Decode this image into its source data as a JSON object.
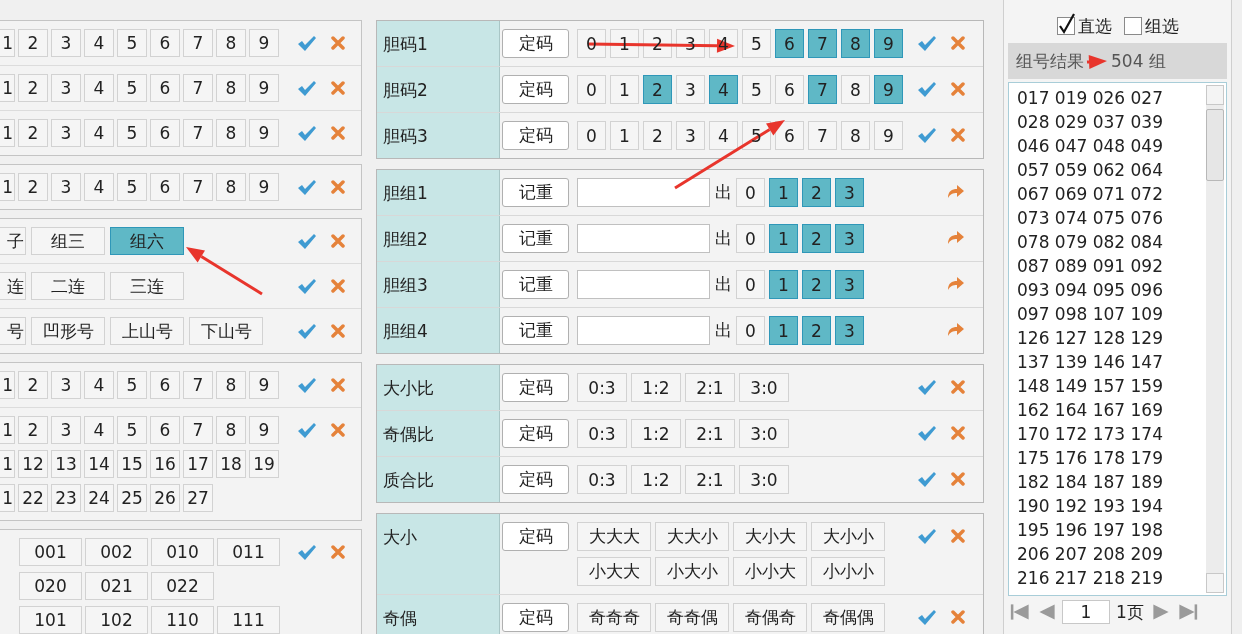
{
  "left_panel": {
    "groups": [
      {
        "kind": "digits",
        "rows": [
          {
            "lines": [
              [
                {
                  "label": "1",
                  "selected": false
                },
                {
                  "label": "2",
                  "selected": false
                },
                {
                  "label": "3",
                  "selected": false
                },
                {
                  "label": "4",
                  "selected": false
                },
                {
                  "label": "5",
                  "selected": false
                },
                {
                  "label": "6",
                  "selected": false
                },
                {
                  "label": "7",
                  "selected": false
                },
                {
                  "label": "8",
                  "selected": false
                },
                {
                  "label": "9",
                  "selected": false
                }
              ]
            ]
          },
          {
            "lines": [
              [
                {
                  "label": "1",
                  "selected": false
                },
                {
                  "label": "2",
                  "selected": false
                },
                {
                  "label": "3",
                  "selected": false
                },
                {
                  "label": "4",
                  "selected": false
                },
                {
                  "label": "5",
                  "selected": false
                },
                {
                  "label": "6",
                  "selected": false
                },
                {
                  "label": "7",
                  "selected": false
                },
                {
                  "label": "8",
                  "selected": false
                },
                {
                  "label": "9",
                  "selected": false
                }
              ]
            ]
          },
          {
            "lines": [
              [
                {
                  "label": "1",
                  "selected": false
                },
                {
                  "label": "2",
                  "selected": false
                },
                {
                  "label": "3",
                  "selected": false
                },
                {
                  "label": "4",
                  "selected": false
                },
                {
                  "label": "5",
                  "selected": false
                },
                {
                  "label": "6",
                  "selected": false
                },
                {
                  "label": "7",
                  "selected": false
                },
                {
                  "label": "8",
                  "selected": false
                },
                {
                  "label": "9",
                  "selected": false
                }
              ]
            ]
          }
        ]
      },
      {
        "kind": "digits",
        "rows": [
          {
            "lines": [
              [
                {
                  "label": "1",
                  "selected": false
                },
                {
                  "label": "2",
                  "selected": false
                },
                {
                  "label": "3",
                  "selected": false
                },
                {
                  "label": "4",
                  "selected": false
                },
                {
                  "label": "5",
                  "selected": false
                },
                {
                  "label": "6",
                  "selected": false
                },
                {
                  "label": "7",
                  "selected": false
                },
                {
                  "label": "8",
                  "selected": false
                },
                {
                  "label": "9",
                  "selected": false
                }
              ]
            ]
          }
        ]
      },
      {
        "kind": "words",
        "rows": [
          {
            "lines": [
              [
                {
                  "label": "子",
                  "selected": false
                },
                {
                  "label": "组三",
                  "selected": false
                },
                {
                  "label": "组六",
                  "selected": true
                }
              ]
            ]
          },
          {
            "lines": [
              [
                {
                  "label": "连",
                  "selected": false
                },
                {
                  "label": "二连",
                  "selected": false
                },
                {
                  "label": "三连",
                  "selected": false
                }
              ]
            ]
          },
          {
            "lines": [
              [
                {
                  "label": "号",
                  "selected": false
                },
                {
                  "label": "凹形号",
                  "selected": false
                },
                {
                  "label": "上山号",
                  "selected": false
                },
                {
                  "label": "下山号",
                  "selected": false
                }
              ]
            ]
          }
        ]
      },
      {
        "kind": "digits",
        "rows": [
          {
            "lines": [
              [
                {
                  "label": "1",
                  "selected": false
                },
                {
                  "label": "2",
                  "selected": false
                },
                {
                  "label": "3",
                  "selected": false
                },
                {
                  "label": "4",
                  "selected": false
                },
                {
                  "label": "5",
                  "selected": false
                },
                {
                  "label": "6",
                  "selected": false
                },
                {
                  "label": "7",
                  "selected": false
                },
                {
                  "label": "8",
                  "selected": false
                },
                {
                  "label": "9",
                  "selected": false
                }
              ]
            ]
          },
          {
            "lines": [
              [
                {
                  "label": "1",
                  "selected": false
                },
                {
                  "label": "2",
                  "selected": false
                },
                {
                  "label": "3",
                  "selected": false
                },
                {
                  "label": "4",
                  "selected": false
                },
                {
                  "label": "5",
                  "selected": false
                },
                {
                  "label": "6",
                  "selected": false
                },
                {
                  "label": "7",
                  "selected": false
                },
                {
                  "label": "8",
                  "selected": false
                },
                {
                  "label": "9",
                  "selected": false
                }
              ],
              [
                {
                  "label": "1",
                  "selected": false
                },
                {
                  "label": "12",
                  "selected": false
                },
                {
                  "label": "13",
                  "selected": false
                },
                {
                  "label": "14",
                  "selected": false
                },
                {
                  "label": "15",
                  "selected": false
                },
                {
                  "label": "16",
                  "selected": false
                },
                {
                  "label": "17",
                  "selected": false
                },
                {
                  "label": "18",
                  "selected": false
                },
                {
                  "label": "19",
                  "selected": false
                }
              ],
              [
                {
                  "label": "1",
                  "selected": false
                },
                {
                  "label": "22",
                  "selected": false
                },
                {
                  "label": "23",
                  "selected": false
                },
                {
                  "label": "24",
                  "selected": false
                },
                {
                  "label": "25",
                  "selected": false
                },
                {
                  "label": "26",
                  "selected": false
                },
                {
                  "label": "27",
                  "selected": false
                }
              ]
            ]
          }
        ]
      },
      {
        "kind": "codes",
        "rows": [
          {
            "lines": [
              [
                {
                  "label": "001",
                  "selected": false
                },
                {
                  "label": "002",
                  "selected": false
                },
                {
                  "label": "010",
                  "selected": false
                },
                {
                  "label": "011",
                  "selected": false
                }
              ],
              [
                {
                  "label": "020",
                  "selected": false
                },
                {
                  "label": "021",
                  "selected": false
                },
                {
                  "label": "022",
                  "selected": false
                }
              ],
              [
                {
                  "label": "101",
                  "selected": false
                },
                {
                  "label": "102",
                  "selected": false
                },
                {
                  "label": "110",
                  "selected": false
                },
                {
                  "label": "111",
                  "selected": false
                }
              ]
            ]
          }
        ]
      }
    ]
  },
  "middle_panel": {
    "sections": [
      {
        "rows": [
          {
            "kind": "digits",
            "label": "胆码1",
            "button": "定码",
            "lines": [
              [
                {
                  "label": "0",
                  "selected": false
                },
                {
                  "label": "1",
                  "selected": false
                },
                {
                  "label": "2",
                  "selected": false
                },
                {
                  "label": "3",
                  "selected": false
                },
                {
                  "label": "4",
                  "selected": false
                },
                {
                  "label": "5",
                  "selected": false
                },
                {
                  "label": "6",
                  "selected": true
                },
                {
                  "label": "7",
                  "selected": true
                },
                {
                  "label": "8",
                  "selected": true
                },
                {
                  "label": "9",
                  "selected": true
                }
              ]
            ]
          },
          {
            "kind": "digits",
            "label": "胆码2",
            "button": "定码",
            "lines": [
              [
                {
                  "label": "0",
                  "selected": false
                },
                {
                  "label": "1",
                  "selected": false
                },
                {
                  "label": "2",
                  "selected": true
                },
                {
                  "label": "3",
                  "selected": false
                },
                {
                  "label": "4",
                  "selected": true
                },
                {
                  "label": "5",
                  "selected": false
                },
                {
                  "label": "6",
                  "selected": false
                },
                {
                  "label": "7",
                  "selected": true
                },
                {
                  "label": "8",
                  "selected": false
                },
                {
                  "label": "9",
                  "selected": true
                }
              ]
            ]
          },
          {
            "kind": "digits",
            "label": "胆码3",
            "button": "定码",
            "lines": [
              [
                {
                  "label": "0",
                  "selected": false
                },
                {
                  "label": "1",
                  "selected": false
                },
                {
                  "label": "2",
                  "selected": false
                },
                {
                  "label": "3",
                  "selected": false
                },
                {
                  "label": "4",
                  "selected": false
                },
                {
                  "label": "5",
                  "selected": false
                },
                {
                  "label": "6",
                  "selected": false
                },
                {
                  "label": "7",
                  "selected": false
                },
                {
                  "label": "8",
                  "selected": false
                },
                {
                  "label": "9",
                  "selected": false
                }
              ]
            ]
          }
        ]
      },
      {
        "rows": [
          {
            "kind": "group",
            "label": "胆组1",
            "button": "记重",
            "out_label": "出",
            "lines": [
              [
                {
                  "label": "0",
                  "selected": false
                },
                {
                  "label": "1",
                  "selected": true
                },
                {
                  "label": "2",
                  "selected": true
                },
                {
                  "label": "3",
                  "selected": true
                }
              ]
            ]
          },
          {
            "kind": "group",
            "label": "胆组2",
            "button": "记重",
            "out_label": "出",
            "lines": [
              [
                {
                  "label": "0",
                  "selected": false
                },
                {
                  "label": "1",
                  "selected": true
                },
                {
                  "label": "2",
                  "selected": true
                },
                {
                  "label": "3",
                  "selected": true
                }
              ]
            ]
          },
          {
            "kind": "group",
            "label": "胆组3",
            "button": "记重",
            "out_label": "出",
            "lines": [
              [
                {
                  "label": "0",
                  "selected": false
                },
                {
                  "label": "1",
                  "selected": true
                },
                {
                  "label": "2",
                  "selected": true
                },
                {
                  "label": "3",
                  "selected": true
                }
              ]
            ]
          },
          {
            "kind": "group",
            "label": "胆组4",
            "button": "记重",
            "out_label": "出",
            "lines": [
              [
                {
                  "label": "0",
                  "selected": false
                },
                {
                  "label": "1",
                  "selected": true
                },
                {
                  "label": "2",
                  "selected": true
                },
                {
                  "label": "3",
                  "selected": true
                }
              ]
            ]
          }
        ]
      },
      {
        "rows": [
          {
            "kind": "ratio",
            "label": "大小比",
            "button": "定码",
            "lines": [
              [
                {
                  "label": "0:3",
                  "selected": false
                },
                {
                  "label": "1:2",
                  "selected": false
                },
                {
                  "label": "2:1",
                  "selected": false
                },
                {
                  "label": "3:0",
                  "selected": false
                }
              ]
            ]
          },
          {
            "kind": "ratio",
            "label": "奇偶比",
            "button": "定码",
            "lines": [
              [
                {
                  "label": "0:3",
                  "selected": false
                },
                {
                  "label": "1:2",
                  "selected": false
                },
                {
                  "label": "2:1",
                  "selected": false
                },
                {
                  "label": "3:0",
                  "selected": false
                }
              ]
            ]
          },
          {
            "kind": "ratio",
            "label": "质合比",
            "button": "定码",
            "lines": [
              [
                {
                  "label": "0:3",
                  "selected": false
                },
                {
                  "label": "1:2",
                  "selected": false
                },
                {
                  "label": "2:1",
                  "selected": false
                },
                {
                  "label": "3:0",
                  "selected": false
                }
              ]
            ]
          }
        ]
      },
      {
        "rows": [
          {
            "kind": "pattern",
            "label": "大小",
            "button": "定码",
            "lines": [
              [
                {
                  "label": "大大大",
                  "selected": false
                },
                {
                  "label": "大大小",
                  "selected": false
                },
                {
                  "label": "大小大",
                  "selected": false
                },
                {
                  "label": "大小小",
                  "selected": false
                }
              ],
              [
                {
                  "label": "小大大",
                  "selected": false
                },
                {
                  "label": "小大小",
                  "selected": false
                },
                {
                  "label": "小小大",
                  "selected": false
                },
                {
                  "label": "小小小",
                  "selected": false
                }
              ]
            ]
          },
          {
            "kind": "pattern",
            "label": "奇偶",
            "button": "定码",
            "lines": [
              [
                {
                  "label": "奇奇奇",
                  "selected": false
                },
                {
                  "label": "奇奇偶",
                  "selected": false
                },
                {
                  "label": "奇偶奇",
                  "selected": false
                },
                {
                  "label": "奇偶偶",
                  "selected": false
                }
              ]
            ]
          }
        ]
      }
    ]
  },
  "right_panel": {
    "mode_options": [
      {
        "label": "直选",
        "checked": true
      },
      {
        "label": "组选",
        "checked": false
      }
    ],
    "result": {
      "label": "组号结果",
      "count": "504 组",
      "lines": [
        "017 019 026 027",
        "028 029 037 039",
        "046 047 048 049",
        "057 059 062 064",
        "067 069 071 072",
        "073 074 075 076",
        "078 079 082 084",
        "087 089 091 092",
        "093 094 095 096",
        "097 098 107 109",
        "126 127 128 129",
        "137 139 146 147",
        "148 149 157 159",
        "162 164 167 169",
        "170 172 173 174",
        "175 176 178 179",
        "182 184 187 189",
        "190 192 193 194",
        "195 196 197 198",
        "206 207 208 209",
        "216 217 218 219"
      ]
    },
    "pager": {
      "page": "1",
      "total": "1页"
    }
  }
}
